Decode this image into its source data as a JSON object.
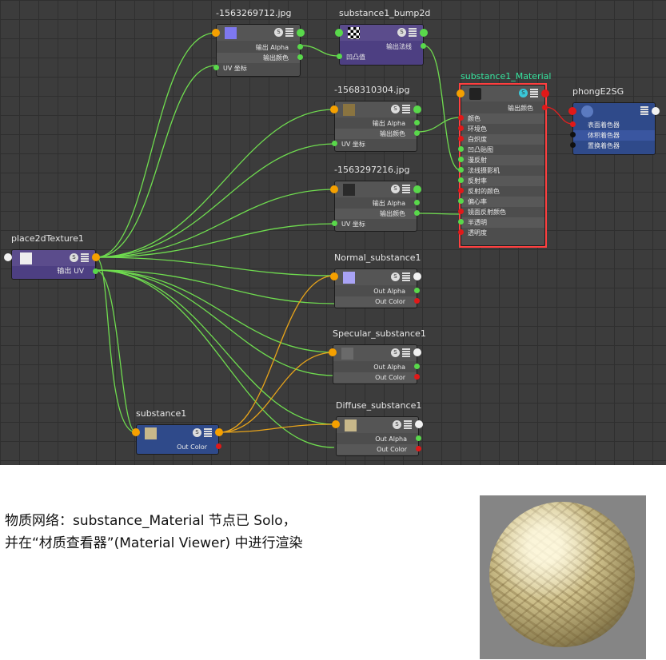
{
  "graph": {
    "nodes": {
      "tex1": {
        "title": "-1563269712.jpg",
        "rows": [
          "输出 Alpha",
          "输出颜色",
          "UV 坐标"
        ],
        "thumb_color": "#7e78f0"
      },
      "bump": {
        "title": "substance1_bump2d",
        "rows": [
          "输出法线",
          "凹凸值"
        ]
      },
      "tex2": {
        "title": "-1568310304.jpg",
        "rows": [
          "输出 Alpha",
          "输出颜色",
          "UV 坐标"
        ]
      },
      "tex3": {
        "title": "-1563297216.jpg",
        "rows": [
          "输出 Alpha",
          "输出颜色",
          "UV 坐标"
        ]
      },
      "material": {
        "title": "substance1_Material",
        "out": "输出颜色",
        "rows": [
          "颜色",
          "环境色",
          "白炽度",
          "凹凸贴图",
          "漫反射",
          "法线摄影机",
          "反射率",
          "反射的颜色",
          "偏心率",
          "镜面反射颜色",
          "半透明",
          "透明度"
        ]
      },
      "sg": {
        "title": "phongE2SG",
        "rows": [
          "表面着色器",
          "体积着色器",
          "置换着色器"
        ]
      },
      "place": {
        "title": "place2dTexture1",
        "rows": [
          "输出 UV"
        ]
      },
      "normal": {
        "title": "Normal_substance1",
        "rows": [
          "Out Alpha",
          "Out Color"
        ],
        "thumb_color": "#a9a3f5"
      },
      "specular": {
        "title": "Specular_substance1",
        "rows": [
          "Out Alpha",
          "Out Color"
        ]
      },
      "diffuse": {
        "title": "Diffuse_substance1",
        "rows": [
          "Out Alpha",
          "Out Color"
        ]
      },
      "substance": {
        "title": "substance1",
        "rows": [
          "Out Color"
        ]
      }
    },
    "colors": {
      "wire_green": "#6fdc4f",
      "wire_orange": "#e8a41a",
      "wire_red": "#e02020",
      "selected": "#ff4040",
      "material_title": "#37e6a0"
    }
  },
  "caption": {
    "line1": "物质网络：substance_Material 节点已 Solo，",
    "line2": "并在“材质查看器”(Material Viewer) 中进行渲染"
  },
  "viewer": {
    "preview": "material-sphere-preview"
  }
}
